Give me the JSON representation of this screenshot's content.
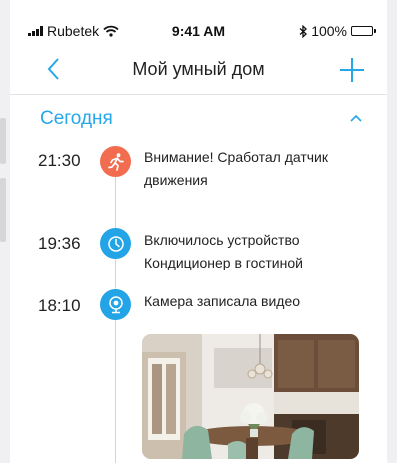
{
  "status_bar": {
    "carrier": "Rubetek",
    "time": "9:41 AM",
    "battery_text": "100%",
    "battery_level": 1.0,
    "icons": [
      "signal-bars-icon",
      "wifi-icon",
      "bluetooth-icon",
      "battery-icon"
    ]
  },
  "nav": {
    "title": "Мой умный дом",
    "back_icon": "chevron-left-icon",
    "add_icon": "plus-icon"
  },
  "section": {
    "title": "Сегодня",
    "collapse_icon": "chevron-up-icon"
  },
  "events": [
    {
      "time": "21:30",
      "text": "Внимание! Сработал датчик движения",
      "icon": "running-person-icon",
      "icon_color": "#f26d4f"
    },
    {
      "time": "19:36",
      "text": "Включилось устройство Кондиционер в гостиной",
      "icon": "clock-icon",
      "icon_color": "#22a4e6"
    },
    {
      "time": "18:10",
      "text": "Камера записала видео",
      "icon": "camera-icon",
      "icon_color": "#22a4e6",
      "thumbnail": "kitchen-video-thumbnail"
    }
  ],
  "colors": {
    "accent": "#26a8e8",
    "alert": "#f26d4f",
    "text": "#222222",
    "timeline": "#d5d5d5"
  }
}
